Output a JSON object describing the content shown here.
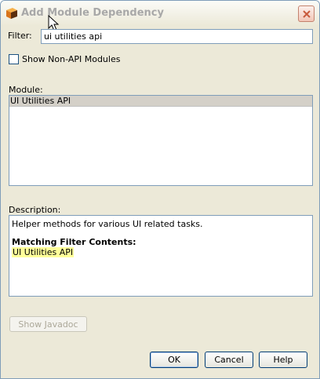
{
  "window": {
    "title": "Add Module Dependency",
    "app_icon": "netbeans-module-icon",
    "close_icon": "close-icon"
  },
  "filter": {
    "label": "Filter:",
    "value": "ui utilities api"
  },
  "show_non_api": {
    "label": "Show Non-API Modules",
    "checked": false
  },
  "module": {
    "label": "Module:",
    "items": [
      {
        "label": "UI Utilities API",
        "selected": true
      }
    ]
  },
  "description": {
    "label": "Description:",
    "text": "Helper methods for various UI related tasks.",
    "heading": "Matching Filter Contents:",
    "match": "UI Utilities API",
    "highlight_color": "#ffff99"
  },
  "buttons": {
    "javadoc": "Show Javadoc",
    "ok": "OK",
    "cancel": "Cancel",
    "help": "Help"
  }
}
